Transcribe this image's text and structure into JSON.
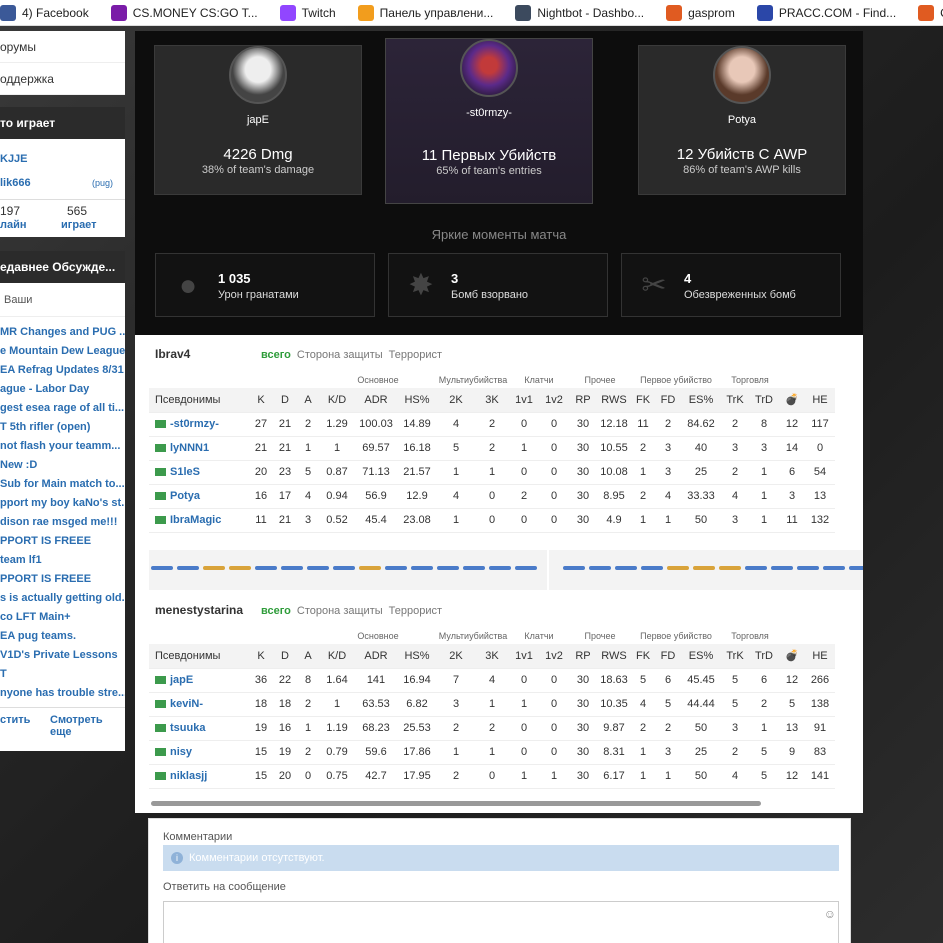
{
  "bookmarks": [
    {
      "label": "4) Facebook",
      "color": "#3b5998"
    },
    {
      "label": "CS.MONEY CS:GO T...",
      "color": "#7a1ca8"
    },
    {
      "label": "Twitch",
      "color": "#9146ff"
    },
    {
      "label": "Панель управлени...",
      "color": "#f29d1d"
    },
    {
      "label": "Nightbot - Dashbo...",
      "color": "#3c4a5e"
    },
    {
      "label": "gasprom",
      "color": "#e05b21"
    },
    {
      "label": "PRACC.COM - Find...",
      "color": "#2b47a8"
    },
    {
      "label": "CS:GO Hom",
      "color": "#e05b21"
    }
  ],
  "sidebar": {
    "links": [
      "орумы",
      "оддержка"
    ],
    "playing_title": "то играет",
    "players": [
      "KJJE",
      "lik666"
    ],
    "players_tag": "(pug)",
    "counts": [
      {
        "value": "197",
        "label": "лайн"
      },
      {
        "value": "565",
        "label": "играет"
      }
    ],
    "discussions_title": "едавнее Обсужде...",
    "discussions_tab": "Ваши",
    "threads": [
      "MR Changes and PUG ...",
      "e Mountain Dew League...",
      "EA Refrag Updates 8/31",
      "ague - Labor Day",
      "gest esea rage of all ti...",
      "T 5th rifler (open)",
      "not flash your teamm...",
      "New :D",
      "Sub for Main match to...",
      "pport my boy kaNo's st...",
      "dison rae msged me!!!",
      "PPORT IS FREEE",
      "team lf1",
      "PPORT IS FREEE",
      "s is actually getting old.",
      "co LFT Main+",
      "EA pug teams.",
      "V1D's Private Lessons",
      "T",
      "nyone has trouble stre..."
    ],
    "footer": [
      "стить",
      "Смотреть еще"
    ]
  },
  "cards": [
    {
      "name": "japE",
      "big": "4226 Dmg",
      "sub": "38% of team's damage"
    },
    {
      "name": "-st0rmzy-",
      "big": "11 Первых Убийств",
      "sub": "65% of team's entries"
    },
    {
      "name": "Potya",
      "big": "12 Убийств С AWP",
      "sub": "86% of team's AWP kills"
    }
  ],
  "highlights_title": "Яркие моменты матча",
  "highlights": [
    {
      "value": "1 035",
      "label": "Урон гранатами",
      "icon": "grenade-icon"
    },
    {
      "value": "3",
      "label": "Бомб взорвано",
      "icon": "explosion-icon"
    },
    {
      "value": "4",
      "label": "Обезвреженных бомб",
      "icon": "defuse-icon"
    }
  ],
  "tabs": [
    "всего",
    "Сторона защиты",
    "Террорист"
  ],
  "groups": [
    "Основное",
    "Мультиубийства",
    "Клатчи",
    "Прочее",
    "Первое убийство",
    "Торговля"
  ],
  "columns": [
    "Псевдонимы",
    "K",
    "D",
    "A",
    "K/D",
    "ADR",
    "HS%",
    "2K",
    "3K",
    "1v1",
    "1v2",
    "RP",
    "RWS",
    "FK",
    "FD",
    "ES%",
    "TrK",
    "TrD",
    "💣",
    "HE"
  ],
  "teams": [
    {
      "name": "Ibrav4",
      "rows": [
        [
          "-st0rmzy-",
          "27",
          "21",
          "2",
          "1.29",
          "100.03",
          "14.89",
          "4",
          "2",
          "0",
          "0",
          "30",
          "12.18",
          "11",
          "2",
          "84.62",
          "2",
          "8",
          "12",
          "117"
        ],
        [
          "lyNNN1",
          "21",
          "21",
          "1",
          "1",
          "69.57",
          "16.18",
          "5",
          "2",
          "1",
          "0",
          "30",
          "10.55",
          "2",
          "3",
          "40",
          "3",
          "3",
          "14",
          "0"
        ],
        [
          "S1leS",
          "20",
          "23",
          "5",
          "0.87",
          "71.13",
          "21.57",
          "1",
          "1",
          "0",
          "0",
          "30",
          "10.08",
          "1",
          "3",
          "25",
          "2",
          "1",
          "6",
          "54"
        ],
        [
          "Potya",
          "16",
          "17",
          "4",
          "0.94",
          "56.9",
          "12.9",
          "4",
          "0",
          "2",
          "0",
          "30",
          "8.95",
          "2",
          "4",
          "33.33",
          "4",
          "1",
          "3",
          "13"
        ],
        [
          "IbraMagic",
          "11",
          "21",
          "3",
          "0.52",
          "45.4",
          "23.08",
          "1",
          "0",
          "0",
          "0",
          "30",
          "4.9",
          "1",
          "1",
          "50",
          "3",
          "1",
          "11",
          "132"
        ]
      ]
    },
    {
      "name": "menestystarina",
      "rows": [
        [
          "japE",
          "36",
          "22",
          "8",
          "1.64",
          "141",
          "16.94",
          "7",
          "4",
          "0",
          "0",
          "30",
          "18.63",
          "5",
          "6",
          "45.45",
          "5",
          "6",
          "12",
          "266"
        ],
        [
          "keviN-",
          "18",
          "18",
          "2",
          "1",
          "63.53",
          "6.82",
          "3",
          "1",
          "1",
          "0",
          "30",
          "10.35",
          "4",
          "5",
          "44.44",
          "5",
          "2",
          "5",
          "138"
        ],
        [
          "tsuuka",
          "19",
          "16",
          "1",
          "1.19",
          "68.23",
          "25.53",
          "2",
          "2",
          "0",
          "0",
          "30",
          "9.87",
          "2",
          "2",
          "50",
          "3",
          "1",
          "13",
          "91"
        ],
        [
          "nisy",
          "15",
          "19",
          "2",
          "0.79",
          "59.6",
          "17.86",
          "1",
          "1",
          "0",
          "0",
          "30",
          "8.31",
          "1",
          "3",
          "25",
          "2",
          "5",
          "9",
          "83"
        ],
        [
          "niklasjj",
          "15",
          "20",
          "0",
          "0.75",
          "42.7",
          "17.95",
          "2",
          "0",
          "1",
          "1",
          "30",
          "6.17",
          "1",
          "1",
          "50",
          "4",
          "5",
          "12",
          "141"
        ]
      ]
    }
  ],
  "comments": {
    "title": "Комментарии",
    "empty": "Комментарии отсутствуют.",
    "reply_label": "Ответить на сообщение"
  }
}
